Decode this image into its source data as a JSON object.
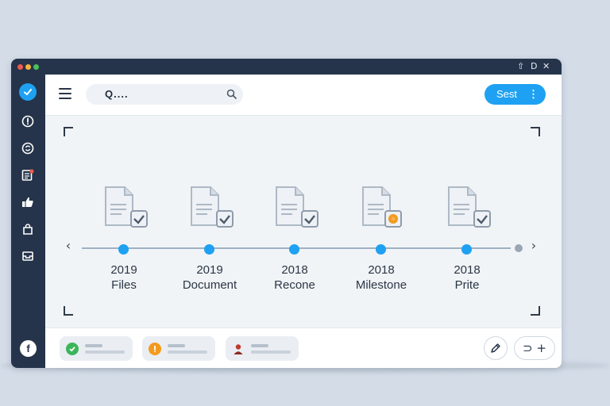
{
  "window": {
    "controls": [
      "⇧",
      "D",
      "✕"
    ]
  },
  "sidebar": {
    "items": [
      {
        "icon": "info-icon"
      },
      {
        "icon": "refresh-icon"
      },
      {
        "icon": "document-notification-icon"
      },
      {
        "icon": "thumbs-up-icon"
      },
      {
        "icon": "bag-icon"
      },
      {
        "icon": "inbox-icon"
      }
    ],
    "footer_icon": "facebook-icon",
    "footer_label": "f"
  },
  "topbar": {
    "search_text": "Q....",
    "primary_button_label": "Sest",
    "primary_button_more": "⋮"
  },
  "timeline": {
    "milestones": [
      {
        "year": "2019",
        "label": "Files",
        "badge": "check"
      },
      {
        "year": "2019",
        "label": "Document",
        "badge": "check"
      },
      {
        "year": "2018",
        "label": "Recone",
        "badge": "check"
      },
      {
        "year": "2018",
        "label": "Milestone",
        "badge": "star"
      },
      {
        "year": "2018",
        "label": "Prite",
        "badge": "check"
      }
    ]
  },
  "bottombar": {
    "chips": [
      {
        "icon": "check-circle-icon",
        "color": "#3bb55a"
      },
      {
        "icon": "alert-circle-icon",
        "color": "#f39a1e"
      },
      {
        "icon": "user-avatar-icon",
        "color": "#c0392b"
      }
    ],
    "action_label": "⊃ +"
  },
  "colors": {
    "accent": "#1ea1f2",
    "sidebar": "#25344a",
    "warning": "#f39a1e",
    "success": "#3bb55a"
  }
}
